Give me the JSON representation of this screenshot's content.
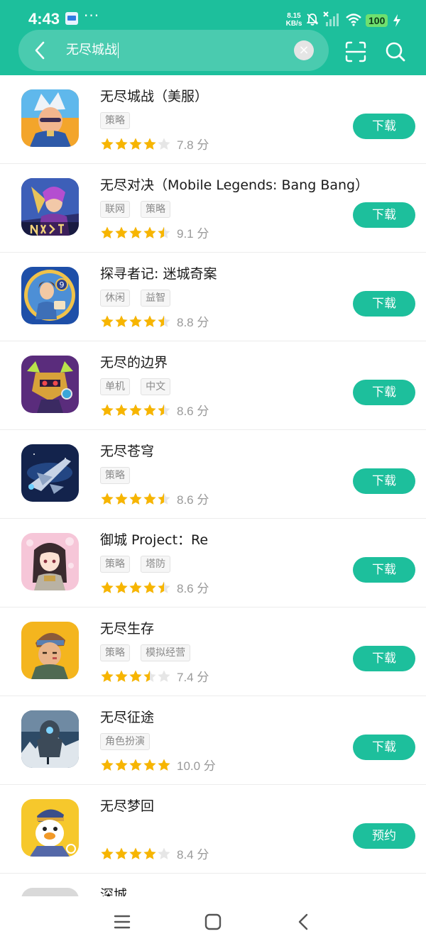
{
  "status_bar": {
    "time": "4:43",
    "more": "···",
    "net_speed_value": "8.15",
    "net_speed_unit": "KB/s",
    "battery": "100",
    "icons": [
      "notes-app-icon",
      "mute-icon",
      "no-sim-icon",
      "signal-icon",
      "wifi-icon",
      "battery-icon",
      "charging-icon"
    ]
  },
  "search": {
    "query": "无尽城战",
    "back_icon": "chevron-left-icon",
    "clear_icon": "clear-icon",
    "clear_symbol": "×",
    "scan_icon": "scan-icon",
    "search_icon": "search-icon"
  },
  "colors": {
    "accent": "#1dbf9c",
    "star_filled": "#f7b500",
    "star_empty": "#e6e6e6"
  },
  "apps": [
    {
      "name": "无尽城战（美服）",
      "tags": [
        "策略"
      ],
      "stars": 4,
      "score": "7.8 分",
      "button": "下载"
    },
    {
      "name": "无尽对决（Mobile Legends: Bang Bang）",
      "tags": [
        "联网",
        "策略"
      ],
      "stars": 4.5,
      "score": "9.1 分",
      "button": "下载"
    },
    {
      "name": "探寻者记: 迷城奇案",
      "tags": [
        "休闲",
        "益智"
      ],
      "stars": 4.5,
      "score": "8.8 分",
      "button": "下载"
    },
    {
      "name": "无尽的边界",
      "tags": [
        "单机",
        "中文"
      ],
      "stars": 4.5,
      "score": "8.6 分",
      "button": "下载"
    },
    {
      "name": "无尽苍穹",
      "tags": [
        "策略"
      ],
      "stars": 4.5,
      "score": "8.6 分",
      "button": "下载"
    },
    {
      "name": "御城 Project：Re",
      "tags": [
        "策略",
        "塔防"
      ],
      "stars": 4.5,
      "score": "8.6 分",
      "button": "下载"
    },
    {
      "name": "无尽生存",
      "tags": [
        "策略",
        "模拟经营"
      ],
      "stars": 3.5,
      "score": "7.4 分",
      "button": "下载"
    },
    {
      "name": "无尽征途",
      "tags": [
        "角色扮演"
      ],
      "stars": 5,
      "score": "10.0 分",
      "button": "下载"
    },
    {
      "name": "无尽梦回",
      "tags": [],
      "stars": 4,
      "score": "8.4 分",
      "button": "预约"
    },
    {
      "name": "深城",
      "tags": [],
      "stars": null,
      "score": "",
      "button": ""
    }
  ],
  "navbar": {
    "icons": [
      "menu-icon",
      "home-icon",
      "back-icon"
    ]
  }
}
